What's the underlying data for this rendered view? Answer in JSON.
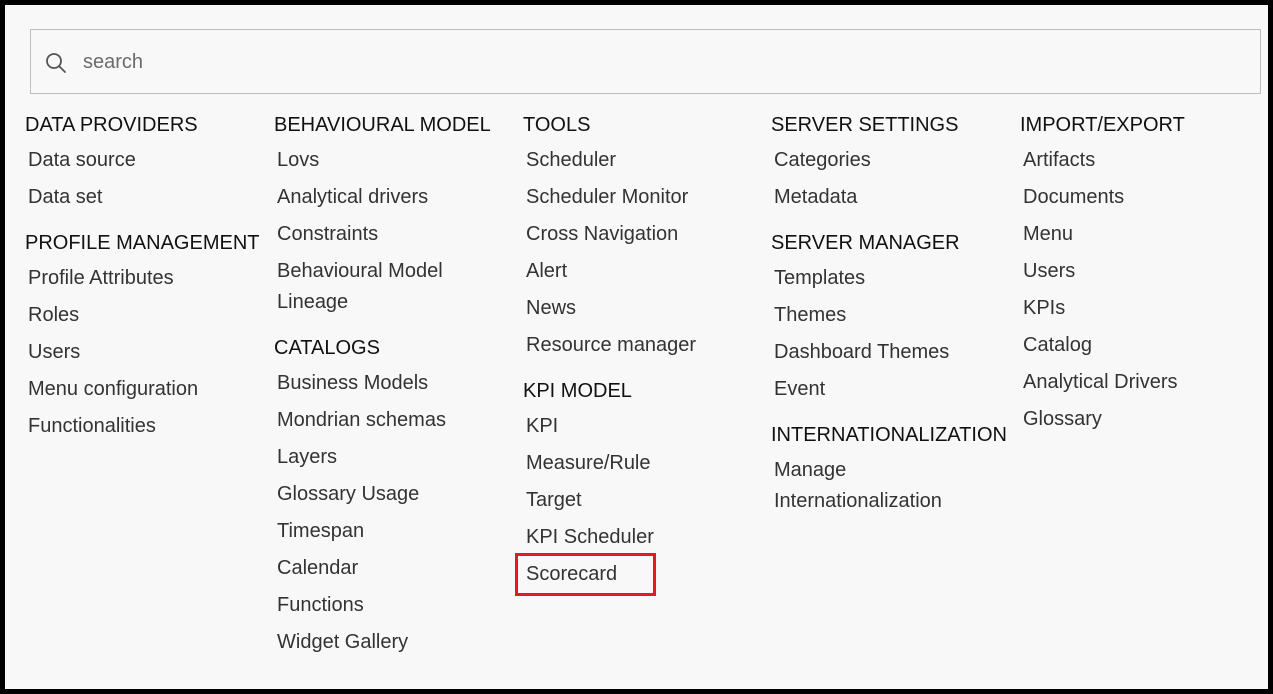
{
  "search": {
    "placeholder": "search",
    "value": ""
  },
  "icons": {
    "search": "search-icon"
  },
  "colors": {
    "highlight": "#e01b24",
    "background": "#f8f8f8",
    "border": "#000000"
  },
  "columns": [
    {
      "sections": [
        {
          "title": "DATA PROVIDERS",
          "items": [
            "Data source",
            "Data set"
          ]
        },
        {
          "title": "PROFILE MANAGEMENT",
          "items": [
            "Profile Attributes",
            "Roles",
            "Users",
            "Menu configuration",
            "Functionalities"
          ]
        }
      ]
    },
    {
      "sections": [
        {
          "title": "BEHAVIOURAL MODEL",
          "items": [
            "Lovs",
            "Analytical drivers",
            "Constraints",
            "Behavioural Model Lineage"
          ]
        },
        {
          "title": "CATALOGS",
          "items": [
            "Business Models",
            "Mondrian schemas",
            "Layers",
            "Glossary Usage",
            "Timespan",
            "Calendar",
            "Functions",
            "Widget Gallery"
          ]
        }
      ]
    },
    {
      "sections": [
        {
          "title": "TOOLS",
          "items": [
            "Scheduler",
            "Scheduler Monitor",
            "Cross Navigation",
            "Alert",
            "News",
            "Resource manager"
          ]
        },
        {
          "title": "KPI MODEL",
          "items": [
            "KPI",
            "Measure/Rule",
            "Target",
            "KPI Scheduler",
            "Scorecard"
          ]
        }
      ]
    },
    {
      "sections": [
        {
          "title": "SERVER SETTINGS",
          "items": [
            "Categories",
            "Metadata"
          ]
        },
        {
          "title": "SERVER MANAGER",
          "items": [
            "Templates",
            "Themes",
            "Dashboard Themes",
            "Event"
          ]
        },
        {
          "title": "INTERNATIONALIZATION",
          "items": [
            "Manage Internationalization"
          ]
        }
      ]
    },
    {
      "sections": [
        {
          "title": "IMPORT/EXPORT",
          "items": [
            "Artifacts",
            "Documents",
            "Menu",
            "Users",
            "KPIs",
            "Catalog",
            "Analytical Drivers",
            "Glossary"
          ]
        }
      ]
    }
  ]
}
